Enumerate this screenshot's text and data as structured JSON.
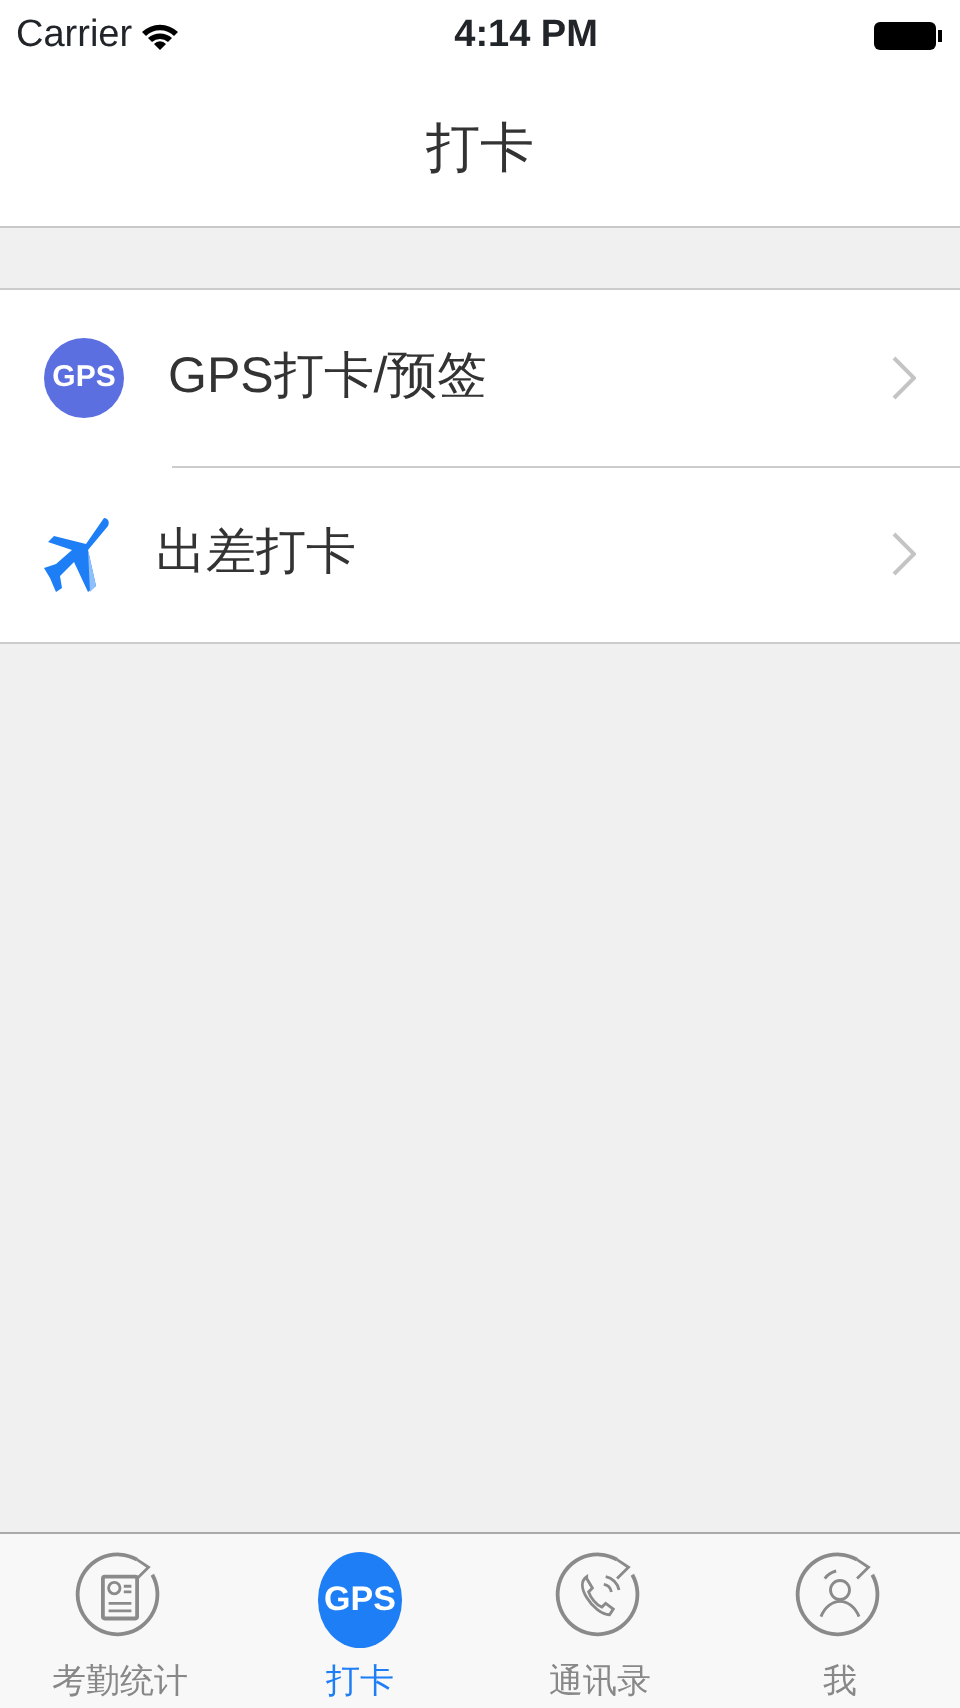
{
  "status_bar": {
    "carrier": "Carrier",
    "time": "4:14 PM"
  },
  "nav_title": "打卡",
  "menu": [
    {
      "kind": "gps",
      "badge": "GPS",
      "label": "GPS打卡/预签"
    },
    {
      "kind": "plane",
      "label": "出差打卡"
    }
  ],
  "tabs": [
    {
      "kind": "report",
      "label": "考勤统计",
      "selected": false
    },
    {
      "kind": "gps",
      "badge": "GPS",
      "label": "打卡",
      "selected": true
    },
    {
      "kind": "phone",
      "label": "通讯录",
      "selected": false
    },
    {
      "kind": "person",
      "label": "我",
      "selected": false
    }
  ]
}
